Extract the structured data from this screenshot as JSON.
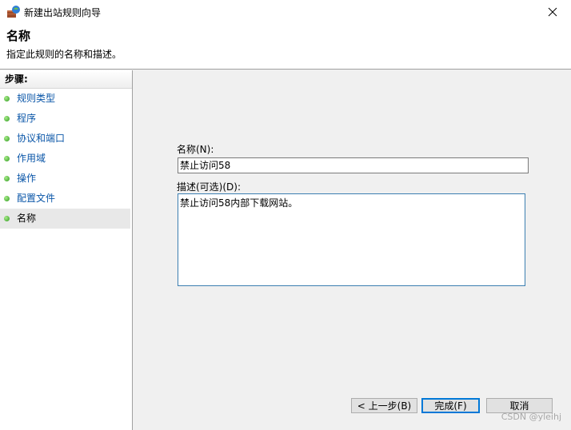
{
  "window": {
    "title": "新建出站规则向导",
    "icon": "firewall-wizard-icon",
    "close_icon": "close-icon"
  },
  "header": {
    "title": "名称",
    "description": "指定此规则的名称和描述。"
  },
  "sidebar": {
    "steps_label": "步骤:",
    "items": [
      {
        "label": "规则类型",
        "active": false
      },
      {
        "label": "程序",
        "active": false
      },
      {
        "label": "协议和端口",
        "active": false
      },
      {
        "label": "作用域",
        "active": false
      },
      {
        "label": "操作",
        "active": false
      },
      {
        "label": "配置文件",
        "active": false
      },
      {
        "label": "名称",
        "active": true
      }
    ]
  },
  "form": {
    "name_label": "名称(N):",
    "name_value": "禁止访问58",
    "description_label": "描述(可选)(D):",
    "description_value": "禁止访问58内部下载网站。"
  },
  "buttons": {
    "back": "< 上一步(B)",
    "finish": "完成(F)",
    "cancel": "取消"
  },
  "watermark": "CSDN @yleihj",
  "colors": {
    "link": "#0a56a8",
    "focus_border": "#0078d7",
    "step_dot": "#2f9a1e"
  }
}
